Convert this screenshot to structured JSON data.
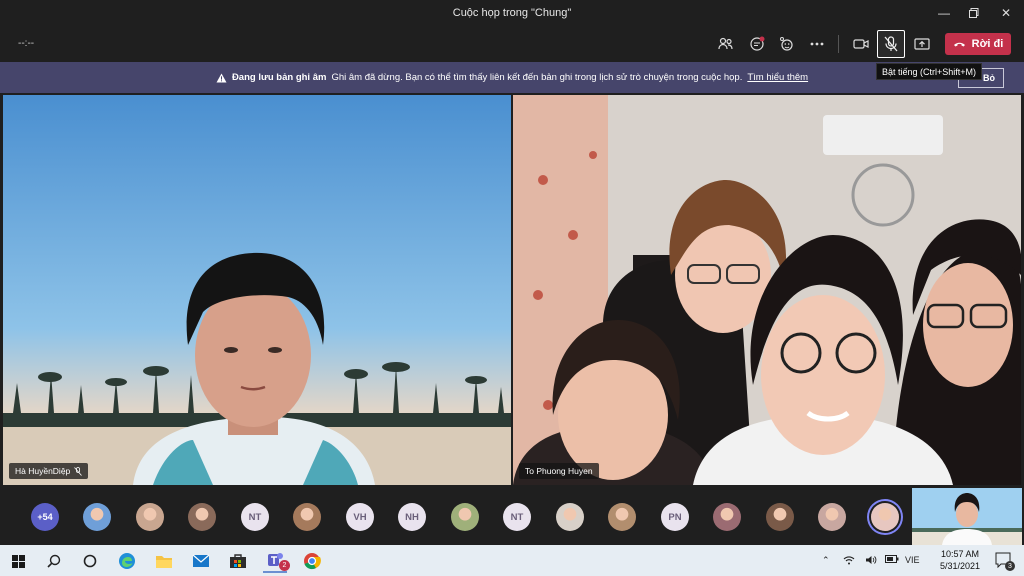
{
  "window": {
    "title": "Cuộc họp trong \"Chung\""
  },
  "toolbar": {
    "timer": "--:--",
    "leave_label": "Rời đi"
  },
  "banner": {
    "heading": "Đang lưu bản ghi âm",
    "message": "Ghi âm đã dừng. Bạn có thể tìm thấy liên kết đến bản ghi trong lịch sử trò chuyện trong cuộc họp.",
    "link": "Tìm hiểu thêm",
    "dismiss_label": "Bỏ"
  },
  "tooltip": {
    "text": "Bật tiếng (Ctrl+Shift+M)"
  },
  "videos": {
    "left_name": "Hà HuyềnDiệp",
    "right_name": "To Phuong Huyen"
  },
  "participants": {
    "more_count": "+54",
    "items": [
      {
        "kind": "photo",
        "color": "#6f9fd8"
      },
      {
        "kind": "photo",
        "color": "#c9a690"
      },
      {
        "kind": "photo",
        "color": "#8a6a5a"
      },
      {
        "kind": "initials",
        "text": "NT"
      },
      {
        "kind": "photo",
        "color": "#a57a5c"
      },
      {
        "kind": "initials",
        "text": "VH"
      },
      {
        "kind": "initials",
        "text": "NH"
      },
      {
        "kind": "photo",
        "color": "#9fb07a"
      },
      {
        "kind": "initials",
        "text": "NT"
      },
      {
        "kind": "photo",
        "color": "#d8d0c8"
      },
      {
        "kind": "photo",
        "color": "#b28e6e"
      },
      {
        "kind": "initials",
        "text": "PN"
      },
      {
        "kind": "photo",
        "color": "#9b6b72"
      },
      {
        "kind": "photo",
        "color": "#7a5a48"
      },
      {
        "kind": "photo",
        "color": "#c8a7a0"
      },
      {
        "kind": "photo",
        "color": "#e7c7c0"
      }
    ]
  },
  "taskbar": {
    "language": "VIE",
    "time": "10:57 AM",
    "date": "5/31/2021",
    "teams_badge": "2",
    "notification_count": "3"
  },
  "colors": {
    "accent": "#5b5fc7",
    "leave": "#c4314b",
    "banner": "#46456b"
  }
}
